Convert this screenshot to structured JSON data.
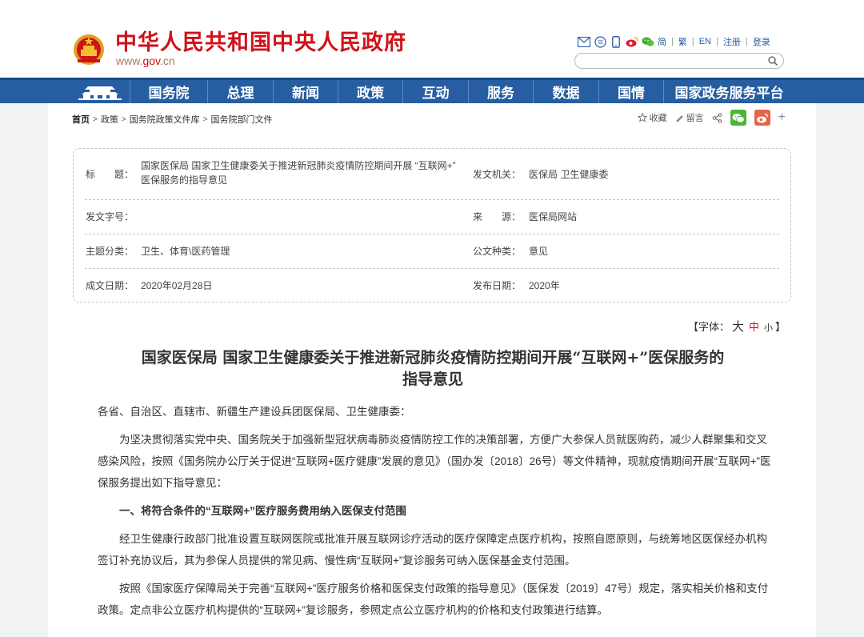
{
  "header": {
    "site_title": "中华人民共和国中央人民政府",
    "domain_prefix": "www.",
    "domain_highlight": "gov",
    "domain_suffix": ".cn",
    "top_links": [
      "简",
      "繁",
      "EN",
      "注册",
      "登录"
    ],
    "search_placeholder": ""
  },
  "nav": {
    "items": [
      "国务院",
      "总理",
      "新闻",
      "政策",
      "互动",
      "服务",
      "数据",
      "国情",
      "国家政务服务平台"
    ]
  },
  "breadcrumb": [
    "首页",
    "政策",
    "国务院政策文件库",
    "国务院部门文件"
  ],
  "tools": {
    "favorite": "收藏",
    "comment": "留言"
  },
  "info": {
    "title_label": "标　　题：",
    "title_value": "国家医保局 国家卫生健康委关于推进新冠肺炎疫情防控期间开展 “互联网+” 医保服务的指导意见",
    "issuer_label": "发文机关：",
    "issuer_value": "医保局 卫生健康委",
    "docno_label": "发文字号：",
    "docno_value": "",
    "source_label": "来　　源：",
    "source_value": "医保局网站",
    "topic_label": "主题分类：",
    "topic_value": "卫生、体育\\医药管理",
    "type_label": "公文种类：",
    "type_value": "意见",
    "written_label": "成文日期：",
    "written_value": "2020年02月28日",
    "published_label": "发布日期：",
    "published_value": "2020年"
  },
  "font_size": {
    "open": "【字体：",
    "big": "大",
    "mid": "中",
    "small": "小",
    "close": "】"
  },
  "document": {
    "title_line1": "国家医保局 国家卫生健康委关于推进新冠肺炎疫情防控期间开展“互联网+”医保服务的",
    "title_line2": "指导意见",
    "salutation": "各省、自治区、直辖市、新疆生产建设兵团医保局、卫生健康委：",
    "para1": "为坚决贯彻落实党中央、国务院关于加强新型冠状病毒肺炎疫情防控工作的决策部署，方便广大参保人员就医购药，减少人群聚集和交叉感染风险，按照《国务院办公厅关于促进“互联网+医疗健康”发展的意见》（国办发〔2018〕26号）等文件精神，现就疫情期间开展“互联网+”医保服务提出如下指导意见：",
    "heading1": "一、将符合条件的“互联网+”医疗服务费用纳入医保支付范围",
    "para2": "经卫生健康行政部门批准设置互联网医院或批准开展互联网诊疗活动的医疗保障定点医疗机构，按照自愿原则，与统筹地区医保经办机构签订补充协议后，其为参保人员提供的常见病、慢性病“互联网+”复诊服务可纳入医保基金支付范围。",
    "para3": "按照《国家医疗保障局关于完善“互联网+”医疗服务价格和医保支付政策的指导意见》（医保发〔2019〕47号）规定，落实相关价格和支付政策。定点非公立医疗机构提供的“互联网+”复诊服务，参照定点公立医疗机构的价格和支付政策进行结算。"
  }
}
